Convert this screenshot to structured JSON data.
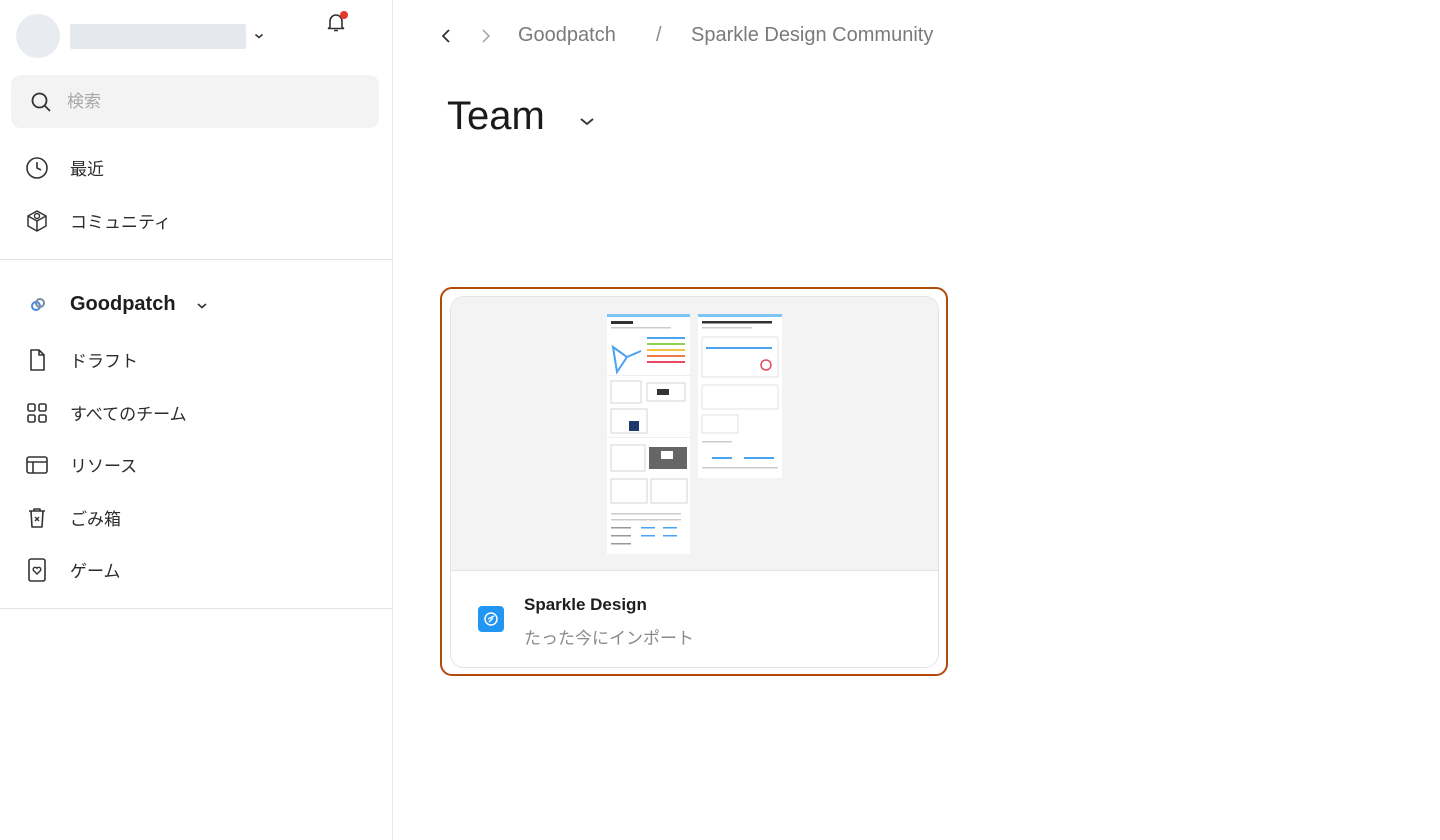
{
  "account": {
    "name": ""
  },
  "search": {
    "placeholder": "検索",
    "value": ""
  },
  "nav_top": [
    {
      "label": "最近",
      "icon": "clock-icon"
    },
    {
      "label": "コミュニティ",
      "icon": "community-icon"
    }
  ],
  "team": {
    "name": "Goodpatch"
  },
  "nav_team": [
    {
      "label": "ドラフト",
      "icon": "file-icon"
    },
    {
      "label": "すべてのチーム",
      "icon": "grid-icon"
    },
    {
      "label": "リソース",
      "icon": "layout-icon"
    },
    {
      "label": "ごみ箱",
      "icon": "trash-icon"
    },
    {
      "label": "ゲーム",
      "icon": "game-icon"
    }
  ],
  "breadcrumb": {
    "items": [
      "Goodpatch",
      "Sparkle Design Community"
    ],
    "separator": "/"
  },
  "page": {
    "title": "Team"
  },
  "files": [
    {
      "name": "Sparkle Design",
      "subtitle": "たった今にインポート"
    }
  ],
  "colors": {
    "accent_focus": "#b24a0c",
    "file_icon_bg": "#2196f3",
    "notification_dot": "#e8372b"
  }
}
